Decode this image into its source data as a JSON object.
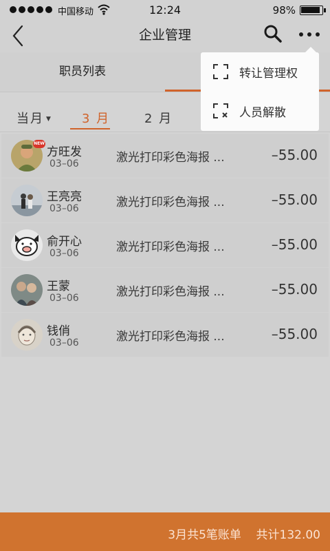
{
  "status_bar": {
    "carrier": "中国移动",
    "time": "12:24",
    "battery": "98%"
  },
  "nav": {
    "title": "企业管理"
  },
  "tabs": [
    {
      "label": "职员列表"
    },
    {
      "label": ""
    }
  ],
  "month_filter": {
    "current_label": "当月",
    "months": [
      "3 月",
      "2 月"
    ],
    "selected": "3 月"
  },
  "records": [
    {
      "name": "方旺发",
      "date": "03–06",
      "desc": "激光打印彩色海报 ...",
      "amount": "–55.00",
      "badge": "NEW",
      "avatar": "avatar-portrait-painting"
    },
    {
      "name": "王亮亮",
      "date": "03–06",
      "desc": "激光打印彩色海报 ...",
      "amount": "–55.00",
      "avatar": "avatar-couple-photo"
    },
    {
      "name": "俞开心",
      "date": "03–06",
      "desc": "激光打印彩色海报 ...",
      "amount": "–55.00",
      "avatar": "avatar-cartoon-pig"
    },
    {
      "name": "王蒙",
      "date": "03–06",
      "desc": "激光打印彩色海报 ...",
      "amount": "–55.00",
      "avatar": "avatar-group-photo"
    },
    {
      "name": "钱俏",
      "date": "03–06",
      "desc": "激光打印彩色海报 ...",
      "amount": "–55.00",
      "avatar": "avatar-sketch-face"
    }
  ],
  "popup_menu": {
    "items": [
      {
        "label": "转让管理权",
        "icon": "transfer-frame-icon"
      },
      {
        "label": "人员解散",
        "icon": "dismiss-frame-icon"
      }
    ]
  },
  "footer": {
    "summary": "3月共5笔账单",
    "total": "共计132.00"
  },
  "colors": {
    "accent": "#d0632b",
    "footer_bg": "#d0732f",
    "overlay_bg": "#d4d4d4"
  }
}
